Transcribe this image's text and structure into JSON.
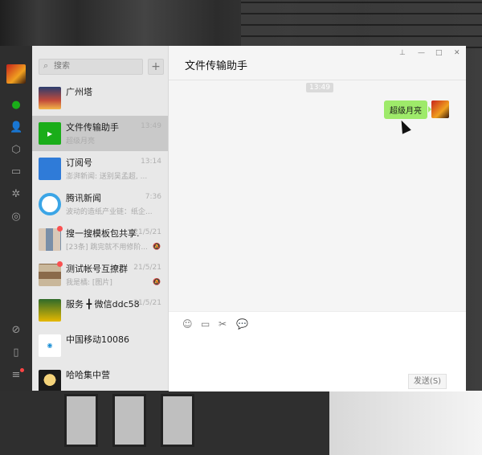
{
  "search": {
    "placeholder": "搜索"
  },
  "add_label": "+",
  "conversations": [
    {
      "name": "广州塔",
      "time": "",
      "preview": "",
      "badge": false
    },
    {
      "name": "文件传输助手",
      "time": "13:49",
      "preview": "超级月亮",
      "badge": false
    },
    {
      "name": "订阅号",
      "time": "13:14",
      "preview": "澎湃新闻: 送别吴孟超, ...",
      "badge": false
    },
    {
      "name": "腾讯新闻",
      "time": "7:36",
      "preview": "波动的造纸产业链：纸企...",
      "badge": false
    },
    {
      "name": "搜一搜模板包共享...",
      "time": "21/5/21",
      "preview": "[23条] 跳完就不用修阶...",
      "badge": true
    },
    {
      "name": "测试帐号互撩群",
      "time": "21/5/21",
      "preview": "我是橘: [图片]",
      "badge": true
    },
    {
      "name": "服务 ╋ 微信ddc587",
      "time": "21/5/21",
      "preview": "",
      "badge": false
    },
    {
      "name": "中国移动10086",
      "time": "",
      "preview": "",
      "badge": false
    },
    {
      "name": "哈哈集中营",
      "time": "",
      "preview": "",
      "badge": false
    }
  ],
  "chat": {
    "title": "文件传输助手",
    "timestamp": "13:49",
    "message": "超级月亮",
    "send_label": "发送(S)"
  },
  "colors": {
    "accent": "#1aad19",
    "bubble": "#9eea6a",
    "sidebar": "#2e2e2e"
  }
}
